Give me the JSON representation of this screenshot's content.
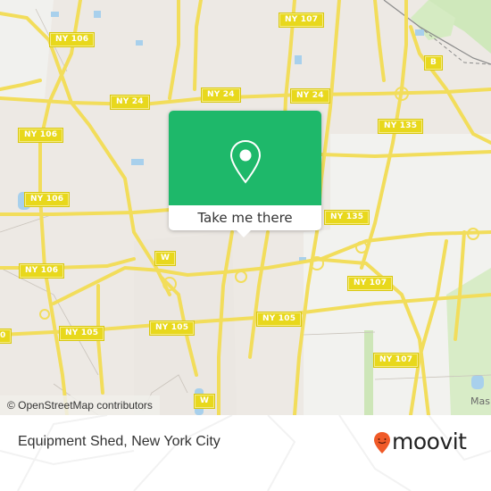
{
  "map": {
    "road_labels": [
      {
        "id": "ny107-top",
        "text": "NY 107"
      },
      {
        "id": "ny106-a",
        "text": "NY 106"
      },
      {
        "id": "ny24-a",
        "text": "NY 24"
      },
      {
        "id": "ny24-b",
        "text": "NY 24"
      },
      {
        "id": "ny24-c",
        "text": "NY 24"
      },
      {
        "id": "b",
        "text": "B"
      },
      {
        "id": "ny106-b",
        "text": "NY 106"
      },
      {
        "id": "ny135-a",
        "text": "NY 135"
      },
      {
        "id": "ny106-c",
        "text": "NY 106"
      },
      {
        "id": "ny135-b",
        "text": "NY 135"
      },
      {
        "id": "w-a",
        "text": "W"
      },
      {
        "id": "ny106-d",
        "text": "NY 106"
      },
      {
        "id": "ny107-b",
        "text": "NY 107"
      },
      {
        "id": "ny105-a",
        "text": "NY 105"
      },
      {
        "id": "ny105-b",
        "text": "NY 105"
      },
      {
        "id": "ny105-c",
        "text": "NY 105"
      },
      {
        "id": "ny107-c",
        "text": "NY 107"
      },
      {
        "id": "w-b",
        "text": "W"
      },
      {
        "id": "partial-left",
        "text": "0"
      }
    ],
    "place_label": "Mas",
    "attribution": "© OpenStreetMap contributors"
  },
  "popup": {
    "icon": "location-pin-icon",
    "label": "Take me there",
    "color": "#1eb86a"
  },
  "footer": {
    "title": "Equipment Shed, New York City",
    "brand": "moovit",
    "brand_color": "#f05a28"
  }
}
